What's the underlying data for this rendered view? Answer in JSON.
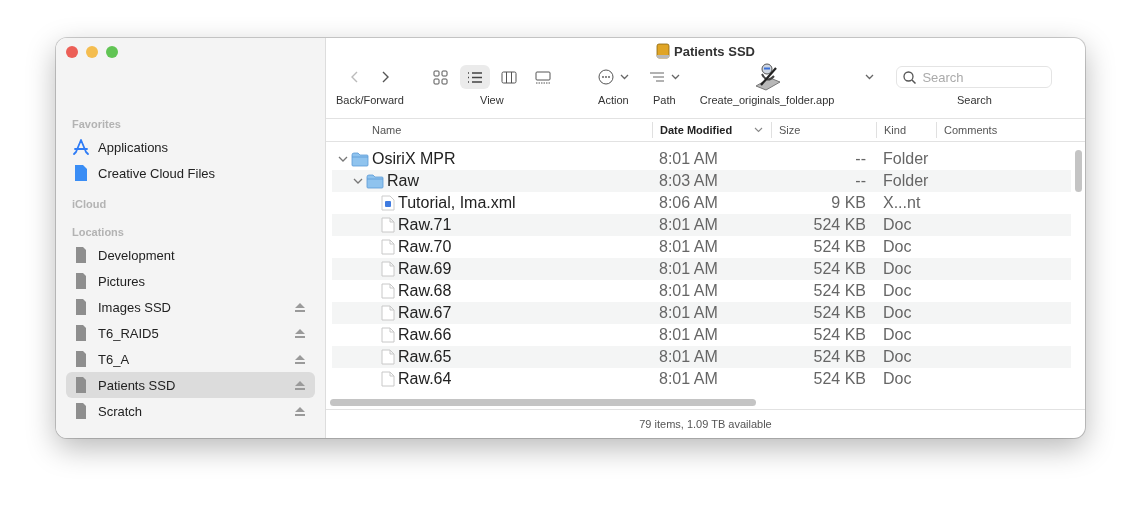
{
  "window": {
    "title": "Patients SSD"
  },
  "sidebar": {
    "sections": [
      {
        "title": "Favorites",
        "items": [
          {
            "label": "Applications",
            "kind": "apps",
            "selected": false,
            "ejectable": false
          },
          {
            "label": "Creative Cloud Files",
            "kind": "file",
            "selected": false,
            "ejectable": false
          }
        ]
      },
      {
        "title": "iCloud"
      },
      {
        "title": "Locations",
        "items": [
          {
            "label": "Development",
            "kind": "drive",
            "selected": false,
            "ejectable": false
          },
          {
            "label": "Pictures",
            "kind": "drive",
            "selected": false,
            "ejectable": false
          },
          {
            "label": "Images SSD",
            "kind": "drive",
            "selected": false,
            "ejectable": true
          },
          {
            "label": "T6_RAID5",
            "kind": "drive",
            "selected": false,
            "ejectable": true
          },
          {
            "label": "T6_A",
            "kind": "drive",
            "selected": false,
            "ejectable": true
          },
          {
            "label": "Patients SSD",
            "kind": "drive",
            "selected": true,
            "ejectable": true
          },
          {
            "label": "Scratch",
            "kind": "drive",
            "selected": false,
            "ejectable": true
          }
        ]
      }
    ]
  },
  "toolbar": {
    "groups": [
      {
        "kind": "nav",
        "label": "Back/Forward"
      },
      {
        "kind": "view",
        "label": "View",
        "modes": [
          {
            "kind": "icons",
            "selected": false
          },
          {
            "kind": "list",
            "selected": true
          },
          {
            "kind": "columns",
            "selected": false
          },
          {
            "kind": "gallery",
            "selected": false
          }
        ]
      },
      {
        "kind": "action",
        "label": "Action"
      },
      {
        "kind": "path",
        "label": "Path"
      },
      {
        "kind": "app",
        "label": "Create_originals_folder.app"
      },
      {
        "kind": "more"
      },
      {
        "kind": "search",
        "label": "Search",
        "placeholder": "Search"
      }
    ]
  },
  "table": {
    "columns": [
      {
        "label": "Name",
        "sorted": false
      },
      {
        "label": "Date Modified",
        "sorted": true
      },
      {
        "label": "Size",
        "sorted": false
      },
      {
        "label": "Kind",
        "sorted": false
      },
      {
        "label": "Comments",
        "sorted": false
      }
    ],
    "rows": [
      {
        "kind": "folder",
        "name": "OsiriX MPR",
        "date": "8:01 AM",
        "size": "--",
        "type": "Folder",
        "expanded": true,
        "children": [
          {
            "kind": "folder",
            "name": "Raw",
            "date": "8:03 AM",
            "size": "--",
            "type": "Folder",
            "expanded": true,
            "children": [
              {
                "kind": "xml",
                "name": "Tutorial, Ima.xml",
                "date": "8:06 AM",
                "size": "9 KB",
                "type": "X...nt"
              },
              {
                "kind": "doc",
                "name": "Raw.71",
                "date": "8:01 AM",
                "size": "524 KB",
                "type": "Doc"
              },
              {
                "kind": "doc",
                "name": "Raw.70",
                "date": "8:01 AM",
                "size": "524 KB",
                "type": "Doc"
              },
              {
                "kind": "doc",
                "name": "Raw.69",
                "date": "8:01 AM",
                "size": "524 KB",
                "type": "Doc"
              },
              {
                "kind": "doc",
                "name": "Raw.68",
                "date": "8:01 AM",
                "size": "524 KB",
                "type": "Doc"
              },
              {
                "kind": "doc",
                "name": "Raw.67",
                "date": "8:01 AM",
                "size": "524 KB",
                "type": "Doc"
              },
              {
                "kind": "doc",
                "name": "Raw.66",
                "date": "8:01 AM",
                "size": "524 KB",
                "type": "Doc"
              },
              {
                "kind": "doc",
                "name": "Raw.65",
                "date": "8:01 AM",
                "size": "524 KB",
                "type": "Doc"
              },
              {
                "kind": "doc",
                "name": "Raw.64",
                "date": "8:01 AM",
                "size": "524 KB",
                "type": "Doc"
              }
            ]
          }
        ]
      }
    ]
  },
  "status_bar": "79 items, 1.09 TB available"
}
